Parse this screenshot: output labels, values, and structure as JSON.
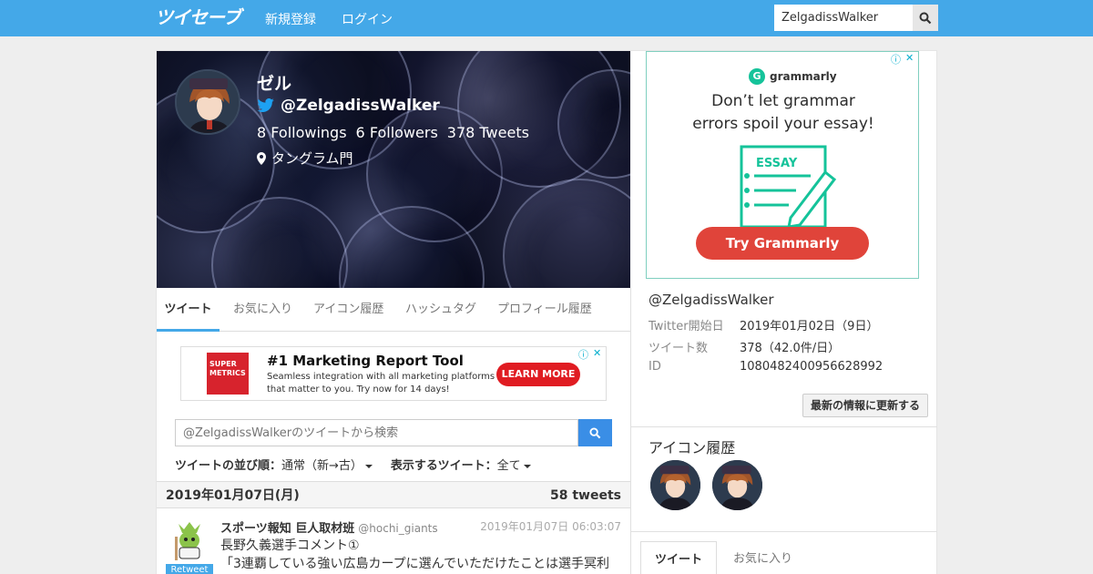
{
  "header": {
    "logo": "ツイセーブ",
    "nav": [
      "新規登録",
      "ログイン"
    ],
    "search_value": "ZelgadissWalker"
  },
  "profile": {
    "name": "ゼル",
    "handle": "@ZelgadissWalker",
    "followings": "8",
    "followings_label": "Followings",
    "followers": "6",
    "followers_label": "Followers",
    "tweets": "378",
    "tweets_label": "Tweets",
    "location": "タングラム門"
  },
  "tabs": [
    "ツイート",
    "お気に入り",
    "アイコン履歴",
    "ハッシュタグ",
    "プロフィール履歴"
  ],
  "ad_top": {
    "brand_lines": [
      "SUPER",
      "METRICS"
    ],
    "title": "#1 Marketing Report Tool",
    "body": "Seamless integration with all marketing platforms that matter to you. Try now for 14 days!",
    "cta": "LEARN MORE"
  },
  "tweet_search": {
    "placeholder": "@ZelgadissWalkerのツイートから検索"
  },
  "sort": {
    "order_label": "ツイートの並び順：",
    "order_value": "通常（新→古）",
    "filter_label": "表示するツイート：",
    "filter_value": "全て"
  },
  "day_header": {
    "date": "2019年01月07日(月)",
    "count": "58 tweets"
  },
  "tweet": {
    "badge": "Retweet",
    "author": "スポーツ報知 巨人取材班",
    "author_handle": "@hochi_giants",
    "time": "2019年01月07日 06:03:07",
    "line1": "長野久義選手コメント①",
    "line2": "「3連覇している強い広島カープに選んでいただけたことは選手冥利"
  },
  "ad_side": {
    "brand": "grammarly",
    "headline_1": "Don’t let grammar",
    "headline_2": "errors spoil your essay!",
    "doc_label": "ESSAY",
    "cta": "Try Grammarly"
  },
  "info": {
    "handle": "@ZelgadissWalker",
    "rows": [
      {
        "k": "Twitter開始日",
        "v": "2019年01月02日（9日）"
      },
      {
        "k": "ツイート数",
        "v": "378（42.0件/日）"
      },
      {
        "k": "ID",
        "v": "1080482400956628992"
      }
    ],
    "refresh": "最新の情報に更新する"
  },
  "icon_history": {
    "title": "アイコン履歴"
  },
  "right_tabs": [
    "ツイート",
    "お気に入り"
  ],
  "colors": {
    "header_bg": "#44a8e8",
    "accent": "#3a8ee6",
    "cta_red": "#e01c22",
    "grammarly_green": "#15c39a"
  }
}
